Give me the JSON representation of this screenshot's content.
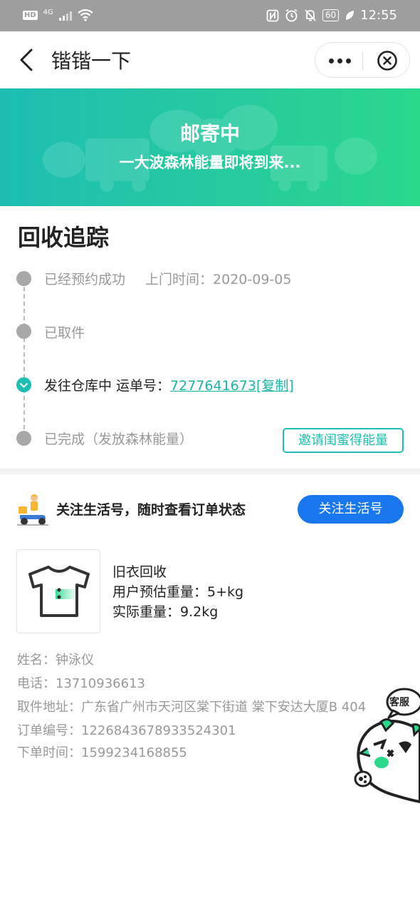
{
  "status_bar": {
    "hd_label": "HD",
    "network_label": "4G",
    "battery_level": "60",
    "time": "12:55",
    "icons": [
      "signal-icon",
      "wifi-icon",
      "nfc-icon",
      "alarm-icon",
      "mute-icon",
      "battery-icon",
      "leaf-icon"
    ]
  },
  "nav": {
    "title": "锴锴一下",
    "icons": [
      "back-arrow-icon",
      "more-icon",
      "close-icon"
    ]
  },
  "banner": {
    "title": "邮寄中",
    "subtitle": "一大波森林能量即将到来..."
  },
  "tracking": {
    "section_title": "回收追踪",
    "steps": [
      {
        "label": "已经预约成功",
        "time_label": "上门时间：2020-09-05",
        "state": "done"
      },
      {
        "label": "已取件",
        "state": "done"
      },
      {
        "label": "发往仓库中 运单号：",
        "waybill": "7277641673",
        "copy_label": "[复制]",
        "state": "current"
      },
      {
        "label": "已完成（发放森林能量）",
        "state": "pending"
      }
    ],
    "invite_button": "邀请闺蜜得能量"
  },
  "follow": {
    "text": "关注生活号，随时查看订单状态",
    "button": "关注生活号"
  },
  "product": {
    "name": "旧衣回收",
    "estimated_weight": "用户预估重量：5+kg",
    "actual_weight": "实际重量：9.2kg"
  },
  "order_info": {
    "name": "姓名：钟泳仪",
    "phone": "电话：13710936613",
    "address": "取件地址：广东省广州市天河区棠下街道 棠下安达大厦B 404",
    "order_no": "订单编号：1226843678933524301",
    "order_time": "下单时间：1599234168855"
  },
  "service": {
    "label": "客服"
  },
  "colors": {
    "accent": "#1cbfb2",
    "banner_start": "#1cbfb2",
    "banner_end": "#2ad88c",
    "primary_button": "#1977ee",
    "muted_text": "#999999"
  }
}
